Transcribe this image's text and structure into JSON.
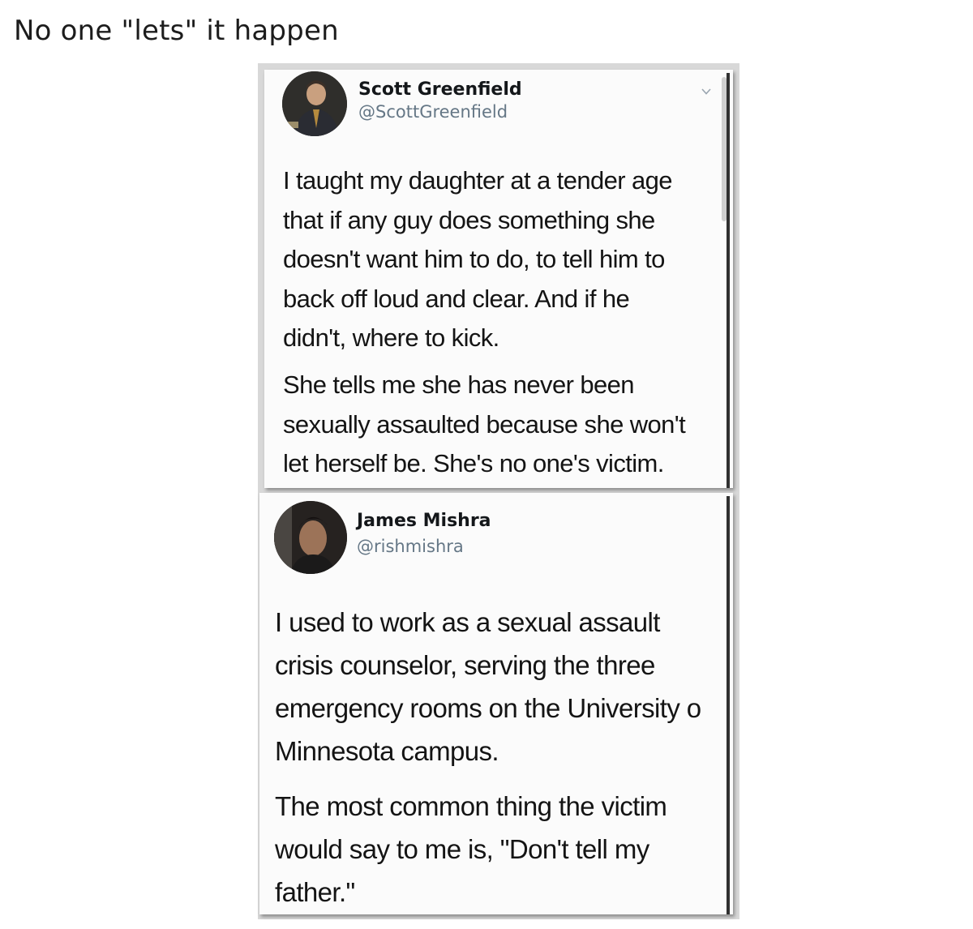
{
  "post": {
    "title": "No one \"lets\" it happen"
  },
  "tweets": [
    {
      "author": "Scott Greenfield",
      "handle": "@ScottGreenfield",
      "paragraphs": [
        [
          "I taught my daughter at a tender age",
          "that if any guy does something she",
          "doesn't want him to do, to tell him to",
          "back off loud and clear. And if he",
          "didn't, where to kick."
        ],
        [
          "She tells me she has never been",
          "sexually assaulted because she won't",
          "let herself be. She's no one's victim."
        ]
      ]
    },
    {
      "author": "James Mishra",
      "handle": "@rishmishra",
      "paragraphs": [
        [
          "I used to work as a sexual assault",
          "crisis counselor, serving the three",
          "emergency rooms on the University o",
          "Minnesota campus."
        ],
        [
          "The most common thing the victim",
          "would say to me is, \"Don't tell my",
          "father.\""
        ]
      ]
    }
  ],
  "icons": {
    "menu": "chevron-down-icon"
  },
  "colors": {
    "name": "#14171a",
    "handle": "#657786",
    "text": "#141414",
    "card": "#fbfbfb"
  }
}
